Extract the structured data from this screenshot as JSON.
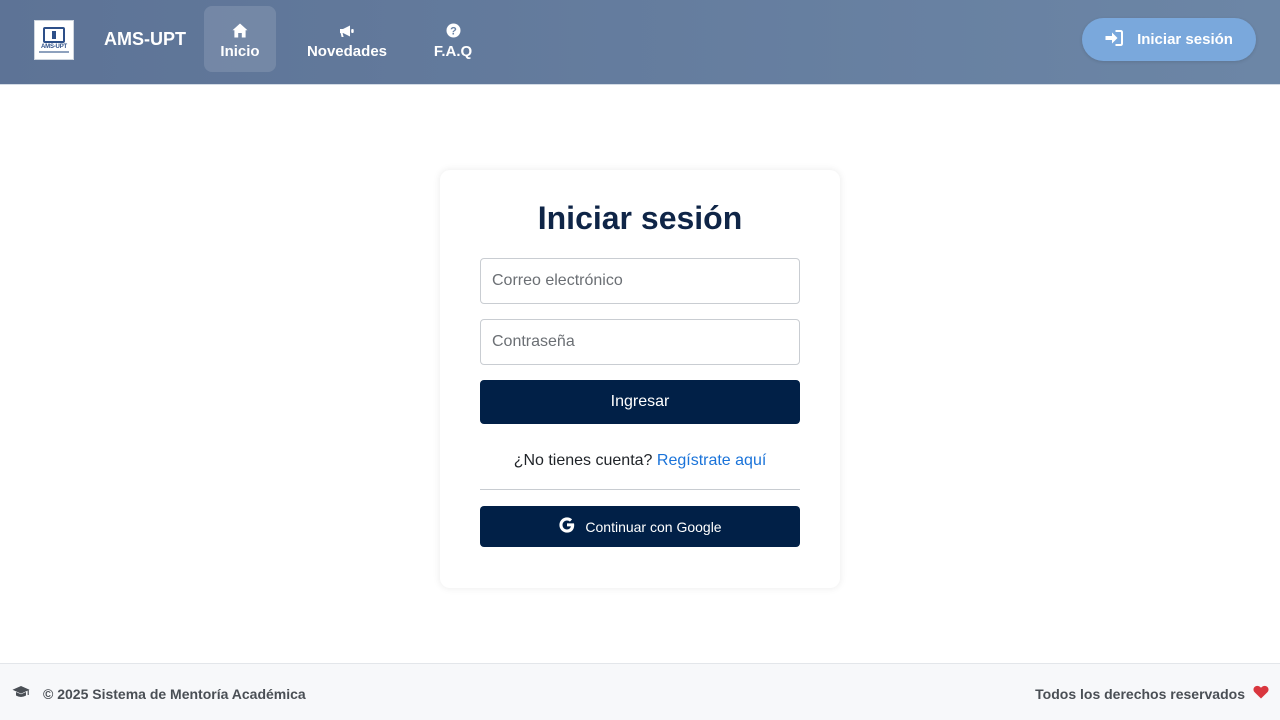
{
  "brand": {
    "name": "AMS-UPT",
    "logo_text": "AMS-UPT"
  },
  "nav": {
    "items": [
      {
        "label": "Inicio",
        "icon": "home-icon",
        "active": true
      },
      {
        "label": "Novedades",
        "icon": "megaphone-icon",
        "active": false
      },
      {
        "label": "F.A.Q",
        "icon": "question-circle-icon",
        "active": false
      }
    ],
    "login_button": "Iniciar sesión"
  },
  "login_card": {
    "title": "Iniciar sesión",
    "email_placeholder": "Correo electrónico",
    "email_value": "",
    "password_placeholder": "Contraseña",
    "password_value": "",
    "submit_label": "Ingresar",
    "no_account_text": "¿No tienes cuenta?",
    "register_link": "Regístrate aquí",
    "google_label": "Continuar con Google"
  },
  "footer": {
    "copyright": "© 2025 Sistema de Mentoría Académica",
    "rights": "Todos los derechos reservados"
  },
  "colors": {
    "navbar": "#6a83a5",
    "primary_button": "#012047",
    "login_pill": "#7aa8dc",
    "link": "#1a73d9",
    "heart": "#d9363e"
  }
}
